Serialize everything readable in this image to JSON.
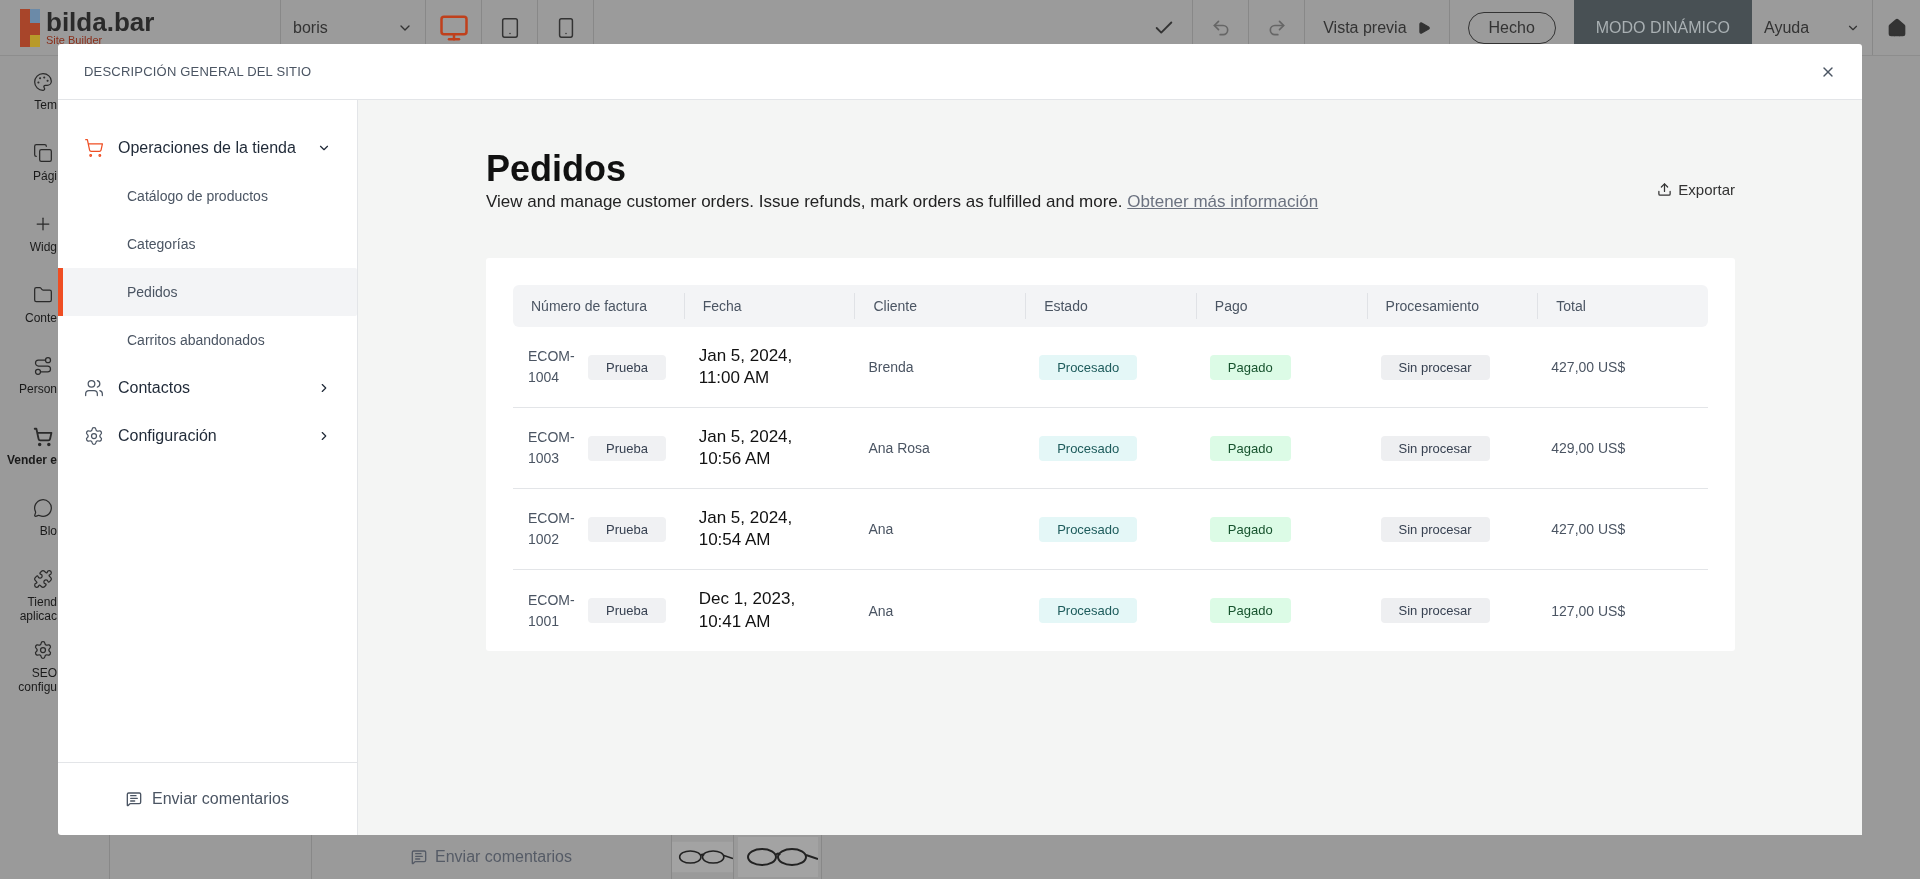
{
  "topbar": {
    "logo": {
      "name": "bilda.bar",
      "subtitle": "Site Builder"
    },
    "site_select": "boris",
    "devices": [
      {
        "kind": "desktop",
        "selected": true
      },
      {
        "kind": "tablet",
        "selected": false
      },
      {
        "kind": "phone",
        "selected": false
      }
    ],
    "preview": "Vista previa",
    "done": "Hecho",
    "mode": "MODO DINÁMICO",
    "help": "Ayuda"
  },
  "background_sidebar": [
    {
      "kind": "palette",
      "label": "Tem",
      "selected": false
    },
    {
      "kind": "pages",
      "label": "Pági",
      "selected": false
    },
    {
      "kind": "plus",
      "label": "Widg",
      "selected": false
    },
    {
      "kind": "folder",
      "label": "Conte",
      "selected": false
    },
    {
      "kind": "path",
      "label": "Person",
      "selected": false
    },
    {
      "kind": "cart",
      "label": "Vender e",
      "selected": true
    },
    {
      "kind": "chat",
      "label": "Blo",
      "selected": false
    },
    {
      "kind": "puzzle",
      "label": [
        "Tiend",
        "aplicac"
      ],
      "selected": false
    },
    {
      "kind": "gear",
      "label": [
        "SEO",
        "configu"
      ],
      "selected": false
    }
  ],
  "background_footer": {
    "feedback": "Enviar comentarios"
  },
  "modal": {
    "title": "DESCRIPCIÓN GENERAL DEL SITIO",
    "nav": [
      {
        "kind": "cart",
        "label": "Operaciones de la tienda",
        "expanded": true,
        "children": [
          {
            "label": "Catálogo de productos",
            "selected": false
          },
          {
            "label": "Categorías",
            "selected": false
          },
          {
            "label": "Pedidos",
            "selected": true
          },
          {
            "label": "Carritos abandonados",
            "selected": false
          }
        ]
      },
      {
        "kind": "users",
        "label": "Contactos",
        "expanded": false
      },
      {
        "kind": "gear",
        "label": "Configuración",
        "expanded": false
      }
    ],
    "feedback": "Enviar comentarios",
    "page": {
      "title": "Pedidos",
      "description": "View and manage customer orders. Issue refunds, mark orders as fulfilled and more.",
      "link": "Obtener más información",
      "export": "Exportar"
    },
    "table": {
      "columns": [
        "Número de factura",
        "Fecha",
        "Cliente",
        "Estado",
        "Pago",
        "Procesamiento",
        "Total"
      ],
      "rows": [
        {
          "invoice": "ECOM-1004",
          "tag": "Prueba",
          "date": "Jan 5, 2024, 11:00 AM",
          "customer": "Brenda",
          "status": "Procesado",
          "payment": "Pagado",
          "processing": "Sin procesar",
          "total": "427,00 US$"
        },
        {
          "invoice": "ECOM-1003",
          "tag": "Prueba",
          "date": "Jan 5, 2024, 10:56 AM",
          "customer": "Ana Rosa",
          "status": "Procesado",
          "payment": "Pagado",
          "processing": "Sin procesar",
          "total": "429,00 US$"
        },
        {
          "invoice": "ECOM-1002",
          "tag": "Prueba",
          "date": "Jan 5, 2024, 10:54 AM",
          "customer": "Ana",
          "status": "Procesado",
          "payment": "Pagado",
          "processing": "Sin procesar",
          "total": "427,00 US$"
        },
        {
          "invoice": "ECOM-1001",
          "tag": "Prueba",
          "date": "Dec 1, 2023, 10:41 AM",
          "customer": "Ana",
          "status": "Procesado",
          "payment": "Pagado",
          "processing": "Sin procesar",
          "total": "127,00 US$"
        }
      ]
    }
  }
}
